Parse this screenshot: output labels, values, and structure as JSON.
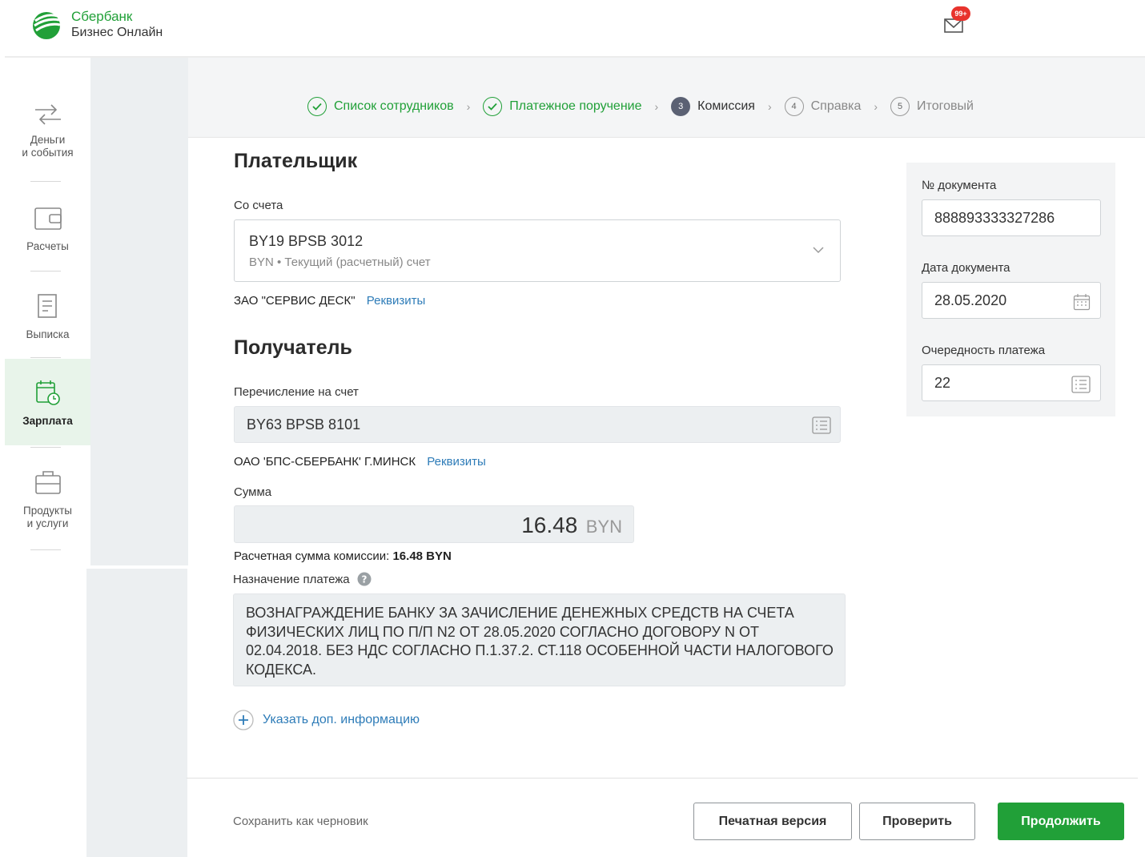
{
  "app": {
    "brand_line1": "Сбербанк",
    "brand_line2": "Бизнес Онлайн"
  },
  "notifications": {
    "badge": "99+"
  },
  "sidebar": {
    "items": [
      {
        "id": "money",
        "label1": "Деньги",
        "label2": "и события"
      },
      {
        "id": "payments",
        "label1": "Расчеты",
        "label2": ""
      },
      {
        "id": "statement",
        "label1": "Выписка",
        "label2": ""
      },
      {
        "id": "salary",
        "label1": "Зарплата",
        "label2": "",
        "active": true
      },
      {
        "id": "products",
        "label1": "Продукты",
        "label2": "и услуги"
      }
    ]
  },
  "stepper": {
    "steps": [
      {
        "num": "",
        "label": "Список сотрудников",
        "state": "done"
      },
      {
        "num": "",
        "label": "Платежное поручение",
        "state": "done"
      },
      {
        "num": "3",
        "label": "Комиссия",
        "state": "current"
      },
      {
        "num": "4",
        "label": "Справка",
        "state": "next"
      },
      {
        "num": "5",
        "label": "Итоговый",
        "state": "next"
      }
    ]
  },
  "payer": {
    "title": "Плательщик",
    "account_label": "Со счета",
    "account_number": "BY19 BPSB 3012",
    "account_type": "BYN • Текущий (расчетный) счет",
    "company": "ЗАО \"СЕРВИС ДЕСК\"",
    "details_link": "Реквизиты"
  },
  "recipient": {
    "title": "Получатель",
    "account_label": "Перечисление на счет",
    "account_number": "BY63 BPSB 8101",
    "bank": "ОАО 'БПС-СБЕРБАНК' Г.МИНСК",
    "details_link": "Реквизиты"
  },
  "amount": {
    "label": "Сумма",
    "value": "16.48",
    "currency": "BYN",
    "commission_label": "Расчетная сумма комиссии:",
    "commission_value": "16.48 BYN"
  },
  "purpose": {
    "label": "Назначение платежа",
    "text": "ВОЗНАГРАЖДЕНИЕ БАНКУ ЗА ЗАЧИСЛЕНИЕ ДЕНЕЖНЫХ СРЕДСТВ НА СЧЕТА ФИЗИЧЕСКИХ ЛИЦ ПО П/П N2 ОТ 28.05.2020 СОГЛАСНО ДОГОВОРУ N ОТ 02.04.2018. БЕЗ НДС СОГЛАСНО П.1.37.2. СТ.118 ОСОБЕННОЙ ЧАСТИ НАЛОГОВОГО КОДЕКСА."
  },
  "add_info": "Указать доп. информацию",
  "document": {
    "number_label": "№ документа",
    "number": "888893333327286",
    "date_label": "Дата документа",
    "date": "28.05.2020",
    "priority_label": "Очередность платежа",
    "priority": "22"
  },
  "footer": {
    "save_draft": "Сохранить как черновик",
    "print": "Печатная версия",
    "check": "Проверить",
    "continue": "Продолжить"
  },
  "colors": {
    "brand": "#21a038",
    "link": "#2e7cb8",
    "badge": "#e8332d",
    "step_current": "#5b6173"
  }
}
